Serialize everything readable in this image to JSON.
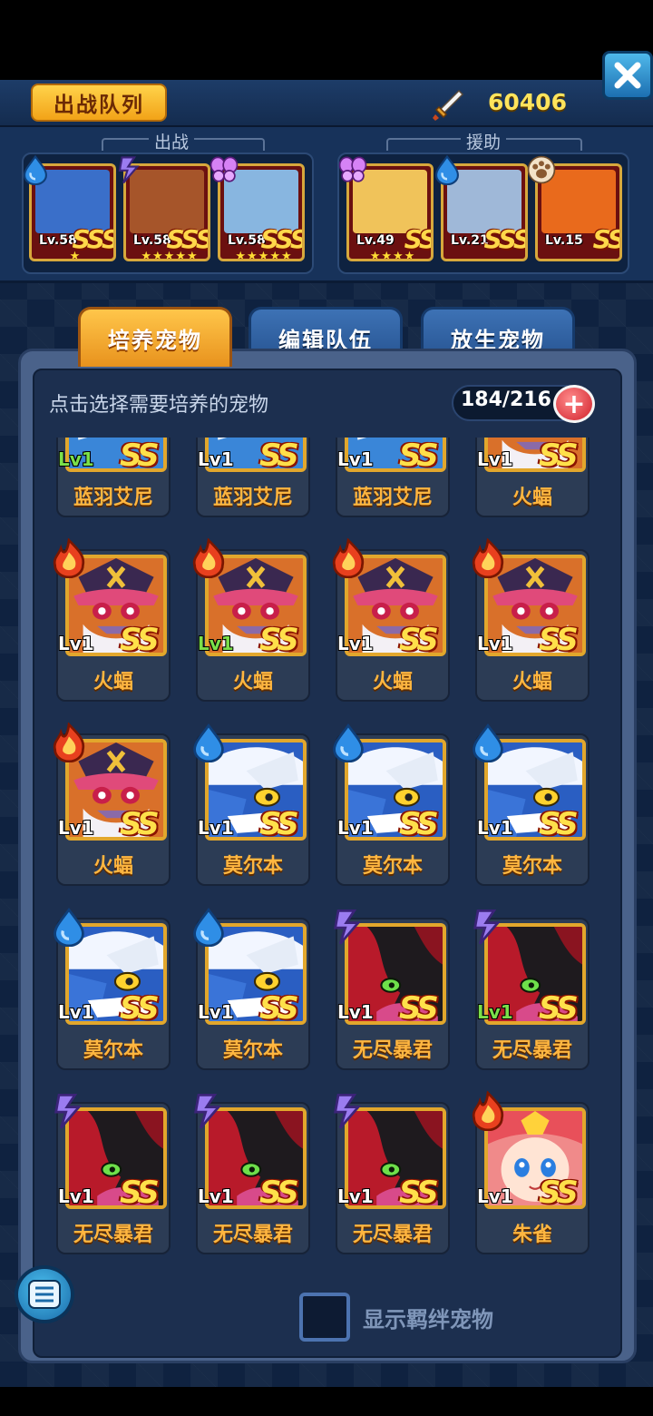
{
  "header": {
    "title": "出战队列",
    "power_value": "60406",
    "power_icon": "sword-icon",
    "close_icon": "close-icon"
  },
  "team": {
    "battle_label": "出战",
    "support_label": "援助",
    "battle": [
      {
        "level": "Lv.58",
        "grade": "SSS",
        "stars": "★",
        "element": "water-drop-icon",
        "color": "#3a6fc9"
      },
      {
        "level": "Lv.58",
        "grade": "SSS",
        "stars": "★★★★★",
        "element": "lightning-icon",
        "color": "#a6552a"
      },
      {
        "level": "Lv.58",
        "grade": "SSS",
        "stars": "★★★★★",
        "element": "butterfly-icon",
        "color": "#88b6e0"
      }
    ],
    "support": [
      {
        "level": "Lv.49",
        "grade": "SS",
        "stars": "★★★★",
        "element": "butterfly-icon",
        "color": "#f0c35a"
      },
      {
        "level": "Lv.21",
        "grade": "SSS",
        "stars": "",
        "element": "water-drop-icon",
        "color": "#9fb8d8"
      },
      {
        "level": "Lv.15",
        "grade": "SS",
        "stars": "",
        "element": "paw-icon",
        "color": "#e96a1c"
      }
    ]
  },
  "tabs": [
    {
      "label": "培养宠物",
      "active": true
    },
    {
      "label": "编辑队伍",
      "active": false
    },
    {
      "label": "放生宠物",
      "active": false
    }
  ],
  "panel": {
    "hint": "点击选择需要培养的宠物",
    "count": "184/216",
    "plus_icon": "plus-icon"
  },
  "pets": [
    {
      "name": "蓝羽艾尼",
      "level": "Lv1",
      "level_green": true,
      "grade": "SS",
      "element": "",
      "art": "blue-white"
    },
    {
      "name": "蓝羽艾尼",
      "level": "Lv1",
      "level_green": false,
      "grade": "SS",
      "element": "",
      "art": "blue-white"
    },
    {
      "name": "蓝羽艾尼",
      "level": "Lv1",
      "level_green": false,
      "grade": "SS",
      "element": "",
      "art": "blue-white"
    },
    {
      "name": "火蝠",
      "level": "Lv1",
      "level_green": false,
      "grade": "SS",
      "element": "",
      "art": "fire-bat"
    },
    {
      "name": "火蝠",
      "level": "Lv1",
      "level_green": false,
      "grade": "SS",
      "element": "fire-icon",
      "art": "fire-bat"
    },
    {
      "name": "火蝠",
      "level": "Lv1",
      "level_green": true,
      "grade": "SS",
      "element": "fire-icon",
      "art": "fire-bat"
    },
    {
      "name": "火蝠",
      "level": "Lv1",
      "level_green": false,
      "grade": "SS",
      "element": "fire-icon",
      "art": "fire-bat"
    },
    {
      "name": "火蝠",
      "level": "Lv1",
      "level_green": false,
      "grade": "SS",
      "element": "fire-icon",
      "art": "fire-bat"
    },
    {
      "name": "火蝠",
      "level": "Lv1",
      "level_green": false,
      "grade": "SS",
      "element": "fire-icon",
      "art": "fire-bat"
    },
    {
      "name": "莫尔本",
      "level": "Lv1",
      "level_green": false,
      "grade": "SS",
      "element": "water-drop-icon",
      "art": "blue-dragon"
    },
    {
      "name": "莫尔本",
      "level": "Lv1",
      "level_green": false,
      "grade": "SS",
      "element": "water-drop-icon",
      "art": "blue-dragon"
    },
    {
      "name": "莫尔本",
      "level": "Lv1",
      "level_green": false,
      "grade": "SS",
      "element": "water-drop-icon",
      "art": "blue-dragon"
    },
    {
      "name": "莫尔本",
      "level": "Lv1",
      "level_green": false,
      "grade": "SS",
      "element": "water-drop-icon",
      "art": "blue-dragon"
    },
    {
      "name": "莫尔本",
      "level": "Lv1",
      "level_green": false,
      "grade": "SS",
      "element": "water-drop-icon",
      "art": "blue-dragon"
    },
    {
      "name": "无尽暴君",
      "level": "Lv1",
      "level_green": false,
      "grade": "SS",
      "element": "lightning-icon",
      "art": "dark-tyrant"
    },
    {
      "name": "无尽暴君",
      "level": "Lv1",
      "level_green": true,
      "grade": "SS",
      "element": "lightning-icon",
      "art": "dark-tyrant"
    },
    {
      "name": "无尽暴君",
      "level": "Lv1",
      "level_green": false,
      "grade": "SS",
      "element": "lightning-icon",
      "art": "dark-tyrant"
    },
    {
      "name": "无尽暴君",
      "level": "Lv1",
      "level_green": false,
      "grade": "SS",
      "element": "lightning-icon",
      "art": "dark-tyrant"
    },
    {
      "name": "无尽暴君",
      "level": "Lv1",
      "level_green": false,
      "grade": "SS",
      "element": "lightning-icon",
      "art": "dark-tyrant"
    },
    {
      "name": "朱雀",
      "level": "Lv1",
      "level_green": false,
      "grade": "SS",
      "element": "fire-icon",
      "art": "vermilion-bird"
    }
  ],
  "footer": {
    "checkbox_label": "显示羁绊宠物",
    "checkbox_checked": false,
    "menu_icon": "menu-list-icon"
  }
}
